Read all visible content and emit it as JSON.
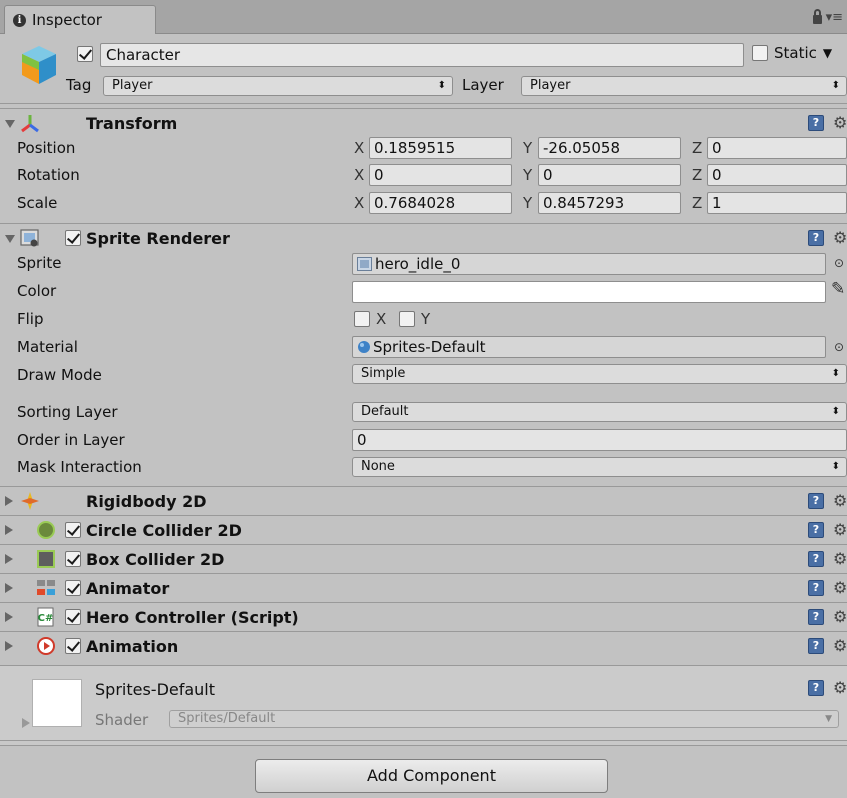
{
  "tab": {
    "label": "Inspector"
  },
  "object": {
    "name": "Character",
    "static_label": "Static",
    "tag_label": "Tag",
    "tag_value": "Player",
    "layer_label": "Layer",
    "layer_value": "Player"
  },
  "transform": {
    "title": "Transform",
    "rows": [
      {
        "label": "Position",
        "x": "0.1859515",
        "y": "-26.05058",
        "z": "0"
      },
      {
        "label": "Rotation",
        "x": "0",
        "y": "0",
        "z": "0"
      },
      {
        "label": "Scale",
        "x": "0.7684028",
        "y": "0.8457293",
        "z": "1"
      }
    ],
    "axis_x": "X",
    "axis_y": "Y",
    "axis_z": "Z"
  },
  "sprite_renderer": {
    "title": "Sprite Renderer",
    "sprite_label": "Sprite",
    "sprite_value": "hero_idle_0",
    "color_label": "Color",
    "color_value": "#ffffff",
    "flip_label": "Flip",
    "flip_x": "X",
    "flip_y": "Y",
    "material_label": "Material",
    "material_value": "Sprites-Default",
    "draw_mode_label": "Draw Mode",
    "draw_mode_value": "Simple",
    "sorting_layer_label": "Sorting Layer",
    "sorting_layer_value": "Default",
    "order_label": "Order in Layer",
    "order_value": "0",
    "mask_label": "Mask Interaction",
    "mask_value": "None"
  },
  "components": [
    {
      "title": "Rigidbody 2D",
      "icon": "rigidbody-icon",
      "checkbox": false
    },
    {
      "title": "Circle Collider 2D",
      "icon": "circle-collider-icon",
      "checkbox": true
    },
    {
      "title": "Box Collider 2D",
      "icon": "box-collider-icon",
      "checkbox": true
    },
    {
      "title": "Animator",
      "icon": "animator-icon",
      "checkbox": true
    },
    {
      "title": "Hero Controller (Script)",
      "icon": "script-icon",
      "checkbox": true
    },
    {
      "title": "Animation",
      "icon": "animation-icon",
      "checkbox": true
    }
  ],
  "material": {
    "name": "Sprites-Default",
    "shader_label": "Shader",
    "shader_value": "Sprites/Default"
  },
  "add_component_label": "Add Component"
}
